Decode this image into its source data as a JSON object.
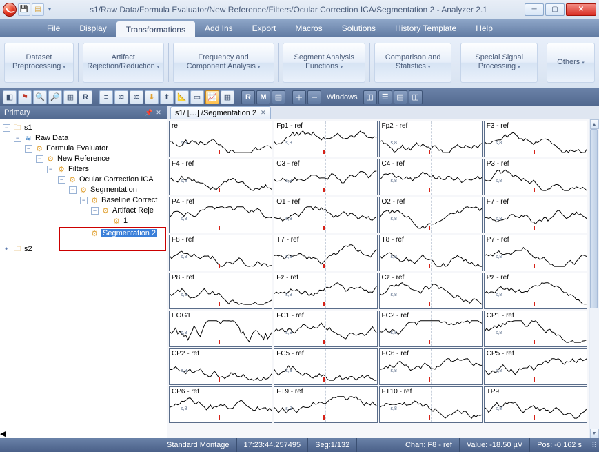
{
  "titlebar": {
    "title": "s1/Raw Data/Formula Evaluator/New Reference/Filters/Ocular Correction ICA/Segmentation 2 - Analyzer 2.1"
  },
  "menu": {
    "items": [
      "File",
      "Display",
      "Transformations",
      "Add Ins",
      "Export",
      "Macros",
      "Solutions",
      "History Template",
      "Help"
    ],
    "active_index": 2
  },
  "ribbon": {
    "groups": [
      {
        "label": "Dataset Preprocessing",
        "dropdown": true
      },
      {
        "label": "Artifact Rejection/Reduction",
        "dropdown": true
      },
      {
        "label": "Frequency and Component Analysis",
        "dropdown": true
      },
      {
        "label": "Segment Analysis Functions",
        "dropdown": true
      },
      {
        "label": "Comparison and Statistics",
        "dropdown": true
      },
      {
        "label": "Special Signal Processing",
        "dropdown": true
      },
      {
        "label": "Others",
        "dropdown": true
      }
    ]
  },
  "toolbar": {
    "windows_label": "Windows"
  },
  "tree": {
    "title": "Primary",
    "root": {
      "label": "s1",
      "icon": "folder"
    },
    "raw": {
      "label": "Raw Data",
      "icon": "wave"
    },
    "fe": {
      "label": "Formula Evaluator",
      "icon": "gear"
    },
    "nr": {
      "label": "New Reference",
      "icon": "gear"
    },
    "fl": {
      "label": "Filters",
      "icon": "gear"
    },
    "oc": {
      "label": "Ocular Correction ICA",
      "icon": "gear"
    },
    "sg": {
      "label": "Segmentation",
      "icon": "gear"
    },
    "bc": {
      "label": "Baseline Correct",
      "icon": "gear"
    },
    "ar": {
      "label": "Artifact Reje",
      "icon": "gear"
    },
    "one": {
      "label": "1",
      "icon": "gear"
    },
    "sg2": {
      "label": "Segmentation 2",
      "icon": "gear",
      "selected": true
    },
    "s2": {
      "label": "s2",
      "icon": "folder"
    }
  },
  "tab": {
    "label": "s1/ […] /Segmentation 2"
  },
  "channels": [
    "re",
    "Fp1 - ref",
    "Fp2 - ref",
    "F3 - ref",
    "F4 - ref",
    "C3 - ref",
    "C4 - ref",
    "P3 - ref",
    "P4 - ref",
    "O1 - ref",
    "O2 - ref",
    "F7 - ref",
    "F8 - ref",
    "T7 - ref",
    "T8 - ref",
    "P7 - ref",
    "P8 - ref",
    "Fz - ref",
    "Cz - ref",
    "Pz - ref",
    "EOG1",
    "FC1 - ref",
    "FC2 - ref",
    "CP1 - ref",
    "CP2 - ref",
    "FC5 - ref",
    "FC6 - ref",
    "CP5 - ref",
    "CP6 - ref",
    "FT9 - ref",
    "FT10 - ref",
    "TP9"
  ],
  "status": {
    "montage": "Standard Montage",
    "time": "17:23:44.257495",
    "seg": "Seg:1/132",
    "chan": "Chan:  F8 - ref",
    "value": "Value: -18.50 µV",
    "pos": "Pos:  -0.162 s"
  },
  "marker": {
    "stext": "s,8"
  }
}
